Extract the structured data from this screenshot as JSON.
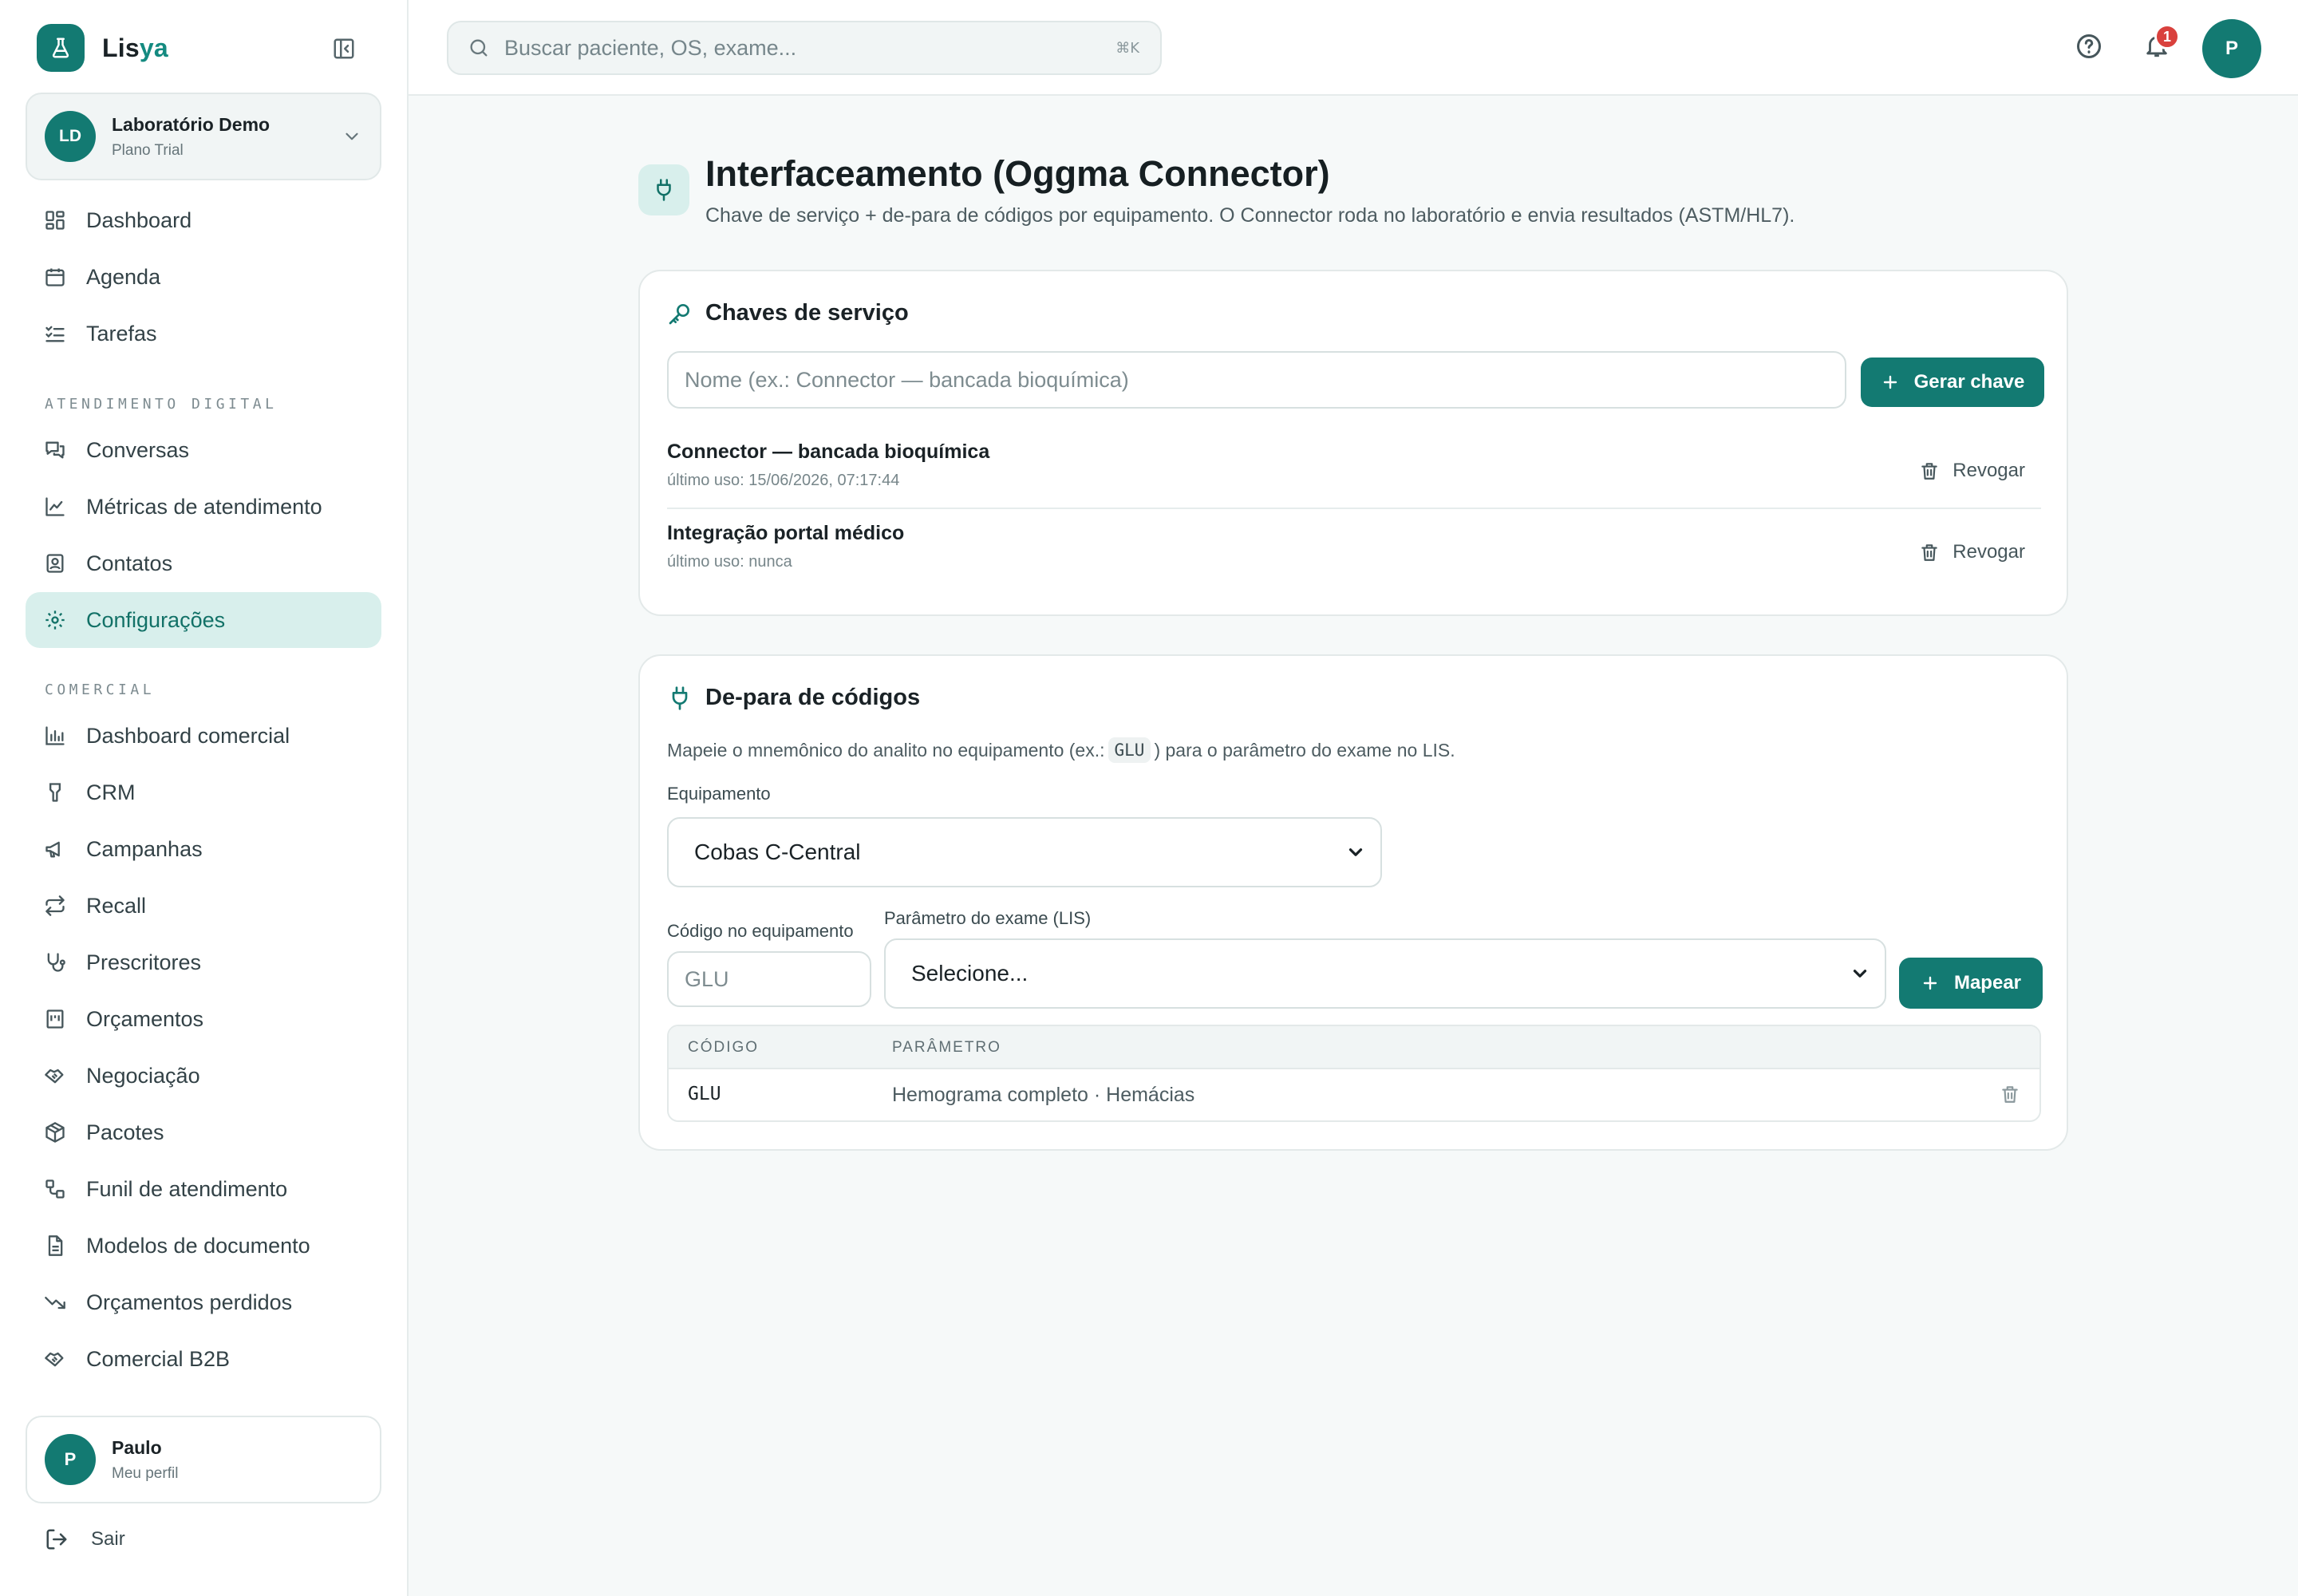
{
  "brand": {
    "name_main": "Lis",
    "name_accent": "ya"
  },
  "org": {
    "initials": "LD",
    "name": "Laboratório Demo",
    "plan": "Plano Trial"
  },
  "nav_main": [
    {
      "label": "Dashboard",
      "icon": "dashboard-icon"
    },
    {
      "label": "Agenda",
      "icon": "calendar-icon"
    },
    {
      "label": "Tarefas",
      "icon": "tasks-icon"
    }
  ],
  "section_atendimento": "ATENDIMENTO DIGITAL",
  "nav_atendimento": [
    {
      "label": "Conversas",
      "icon": "chat-icon"
    },
    {
      "label": "Métricas de atendimento",
      "icon": "line-chart-icon"
    },
    {
      "label": "Contatos",
      "icon": "contacts-icon"
    },
    {
      "label": "Configurações",
      "icon": "gear-icon",
      "active": true
    }
  ],
  "section_comercial": "COMERCIAL",
  "nav_comercial": [
    {
      "label": "Dashboard comercial",
      "icon": "bar-chart-icon"
    },
    {
      "label": "CRM",
      "icon": "funnel-icon"
    },
    {
      "label": "Campanhas",
      "icon": "megaphone-icon"
    },
    {
      "label": "Recall",
      "icon": "repeat-icon"
    },
    {
      "label": "Prescritores",
      "icon": "stethoscope-icon"
    },
    {
      "label": "Orçamentos",
      "icon": "receipt-icon"
    },
    {
      "label": "Negociação",
      "icon": "handshake-icon"
    },
    {
      "label": "Pacotes",
      "icon": "package-icon"
    },
    {
      "label": "Funil de atendimento",
      "icon": "workflow-icon"
    },
    {
      "label": "Modelos de documento",
      "icon": "document-icon"
    },
    {
      "label": "Orçamentos perdidos",
      "icon": "trending-down-icon"
    },
    {
      "label": "Comercial B2B",
      "icon": "handshake-icon"
    }
  ],
  "profile": {
    "initial": "P",
    "name": "Paulo",
    "sub": "Meu perfil"
  },
  "logout_label": "Sair",
  "topbar": {
    "search_placeholder": "Buscar paciente, OS, exame...",
    "search_shortcut": "⌘K",
    "notifications_count": "1",
    "user_initial": "P"
  },
  "page": {
    "title": "Interfaceamento (Oggma Connector)",
    "subtitle": "Chave de serviço + de-para de códigos por equipamento. O Connector roda no laboratório e envia resultados (ASTM/HL7)."
  },
  "keys_card": {
    "title": "Chaves de serviço",
    "name_placeholder": "Nome (ex.: Connector — bancada bioquímica)",
    "generate_label": "Gerar chave",
    "revoke_label": "Revogar",
    "keys": [
      {
        "name": "Connector — bancada bioquímica",
        "last_use": "último uso: 15/06/2026, 07:17:44"
      },
      {
        "name": "Integração portal médico",
        "last_use": "último uso: nunca"
      }
    ]
  },
  "mapping_card": {
    "title": "De-para de códigos",
    "hint_before": "Mapeie o mnemônico do analito no equipamento (ex.:",
    "hint_code": "GLU",
    "hint_after": ") para o parâmetro do exame no LIS.",
    "equipment_label": "Equipamento",
    "equipment_value": "Cobas C-Central",
    "code_label": "Código no equipamento",
    "code_placeholder": "GLU",
    "param_label": "Parâmetro do exame (LIS)",
    "param_value": "Selecione...",
    "map_label": "Mapear",
    "columns": [
      "CÓDIGO",
      "PARÂMETRO"
    ],
    "rows": [
      {
        "code": "GLU",
        "param": "Hemograma completo · Hemácias"
      }
    ]
  },
  "colors": {
    "accent": "#137a72",
    "active_bg": "#d8efec",
    "badge": "#d9413d"
  }
}
